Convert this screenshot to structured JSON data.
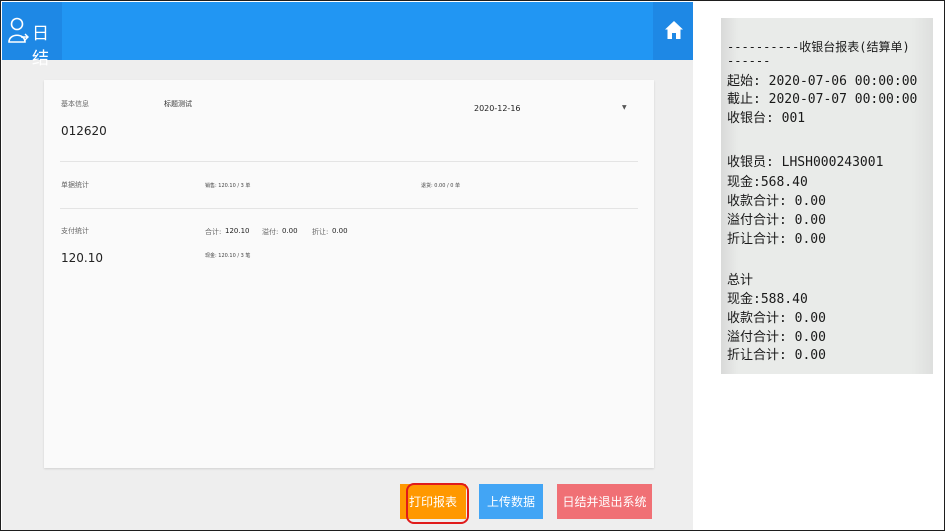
{
  "header": {
    "title": "日结",
    "icon": "user-switch-icon",
    "home_icon": "home-icon"
  },
  "summary": {
    "basic_info_label": "基本信息",
    "title_test": "标题测试",
    "code": "012620",
    "date": "2020-12-16",
    "documents_label": "单据统计",
    "sales_line": "销售: 120.10 / 3 单",
    "returns_line": "退货: 0.00 / 0 单",
    "payments_label": "支付统计",
    "total_label": "合计:",
    "total_value": "120.10",
    "overflow_label": "溢付:",
    "overflow_value": "0.00",
    "discount_label": "折让:",
    "discount_value": "0.00",
    "payment_total": "120.10",
    "cash_line": "现金: 120.10 / 3 笔"
  },
  "buttons": {
    "print": "打印报表",
    "upload": "上传数据",
    "close_exit": "日结并退出系统"
  },
  "receipt": {
    "lines": [
      "----------收银台报表(结算单)",
      "------",
      "起始: 2020-07-06 00:00:00",
      "截止: 2020-07-07 00:00:00",
      "收银台: 001",
      "收银员: LHSH000243001",
      "现金:568.40",
      "收款合计: 0.00",
      "溢付合计: 0.00",
      "折让合计: 0.00",
      "总计",
      "现金:588.40",
      "收款合计: 0.00",
      "溢付合计: 0.00",
      "折让合计: 0.00"
    ]
  },
  "colors": {
    "header": "#2196f3",
    "print_button": "#ff9800",
    "upload_button": "#42a5f5",
    "exit_button": "#f07075",
    "highlight": "#e01b1b"
  }
}
